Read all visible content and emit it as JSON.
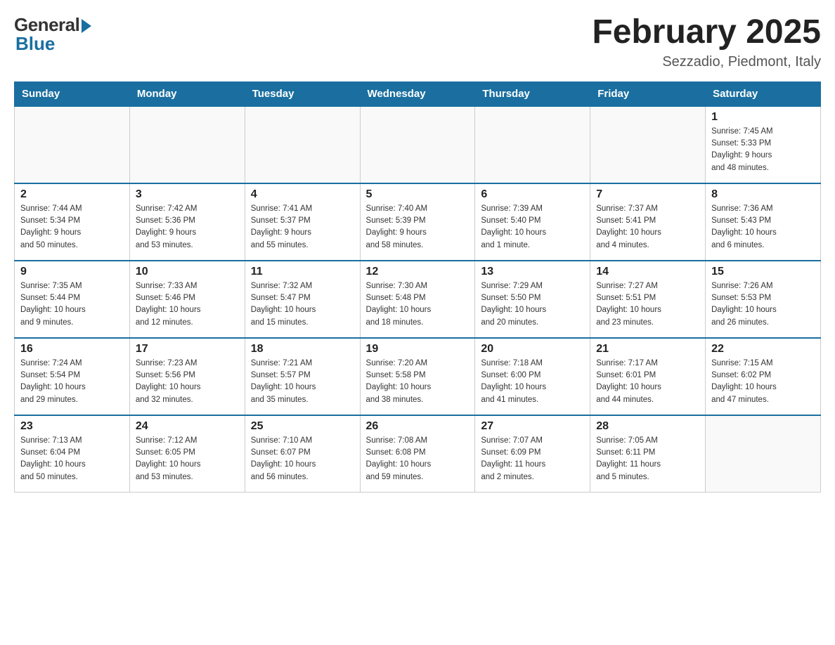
{
  "logo": {
    "general": "General",
    "blue": "Blue"
  },
  "title": "February 2025",
  "subtitle": "Sezzadio, Piedmont, Italy",
  "days_of_week": [
    "Sunday",
    "Monday",
    "Tuesday",
    "Wednesday",
    "Thursday",
    "Friday",
    "Saturday"
  ],
  "weeks": [
    [
      {
        "day": "",
        "info": ""
      },
      {
        "day": "",
        "info": ""
      },
      {
        "day": "",
        "info": ""
      },
      {
        "day": "",
        "info": ""
      },
      {
        "day": "",
        "info": ""
      },
      {
        "day": "",
        "info": ""
      },
      {
        "day": "1",
        "info": "Sunrise: 7:45 AM\nSunset: 5:33 PM\nDaylight: 9 hours\nand 48 minutes."
      }
    ],
    [
      {
        "day": "2",
        "info": "Sunrise: 7:44 AM\nSunset: 5:34 PM\nDaylight: 9 hours\nand 50 minutes."
      },
      {
        "day": "3",
        "info": "Sunrise: 7:42 AM\nSunset: 5:36 PM\nDaylight: 9 hours\nand 53 minutes."
      },
      {
        "day": "4",
        "info": "Sunrise: 7:41 AM\nSunset: 5:37 PM\nDaylight: 9 hours\nand 55 minutes."
      },
      {
        "day": "5",
        "info": "Sunrise: 7:40 AM\nSunset: 5:39 PM\nDaylight: 9 hours\nand 58 minutes."
      },
      {
        "day": "6",
        "info": "Sunrise: 7:39 AM\nSunset: 5:40 PM\nDaylight: 10 hours\nand 1 minute."
      },
      {
        "day": "7",
        "info": "Sunrise: 7:37 AM\nSunset: 5:41 PM\nDaylight: 10 hours\nand 4 minutes."
      },
      {
        "day": "8",
        "info": "Sunrise: 7:36 AM\nSunset: 5:43 PM\nDaylight: 10 hours\nand 6 minutes."
      }
    ],
    [
      {
        "day": "9",
        "info": "Sunrise: 7:35 AM\nSunset: 5:44 PM\nDaylight: 10 hours\nand 9 minutes."
      },
      {
        "day": "10",
        "info": "Sunrise: 7:33 AM\nSunset: 5:46 PM\nDaylight: 10 hours\nand 12 minutes."
      },
      {
        "day": "11",
        "info": "Sunrise: 7:32 AM\nSunset: 5:47 PM\nDaylight: 10 hours\nand 15 minutes."
      },
      {
        "day": "12",
        "info": "Sunrise: 7:30 AM\nSunset: 5:48 PM\nDaylight: 10 hours\nand 18 minutes."
      },
      {
        "day": "13",
        "info": "Sunrise: 7:29 AM\nSunset: 5:50 PM\nDaylight: 10 hours\nand 20 minutes."
      },
      {
        "day": "14",
        "info": "Sunrise: 7:27 AM\nSunset: 5:51 PM\nDaylight: 10 hours\nand 23 minutes."
      },
      {
        "day": "15",
        "info": "Sunrise: 7:26 AM\nSunset: 5:53 PM\nDaylight: 10 hours\nand 26 minutes."
      }
    ],
    [
      {
        "day": "16",
        "info": "Sunrise: 7:24 AM\nSunset: 5:54 PM\nDaylight: 10 hours\nand 29 minutes."
      },
      {
        "day": "17",
        "info": "Sunrise: 7:23 AM\nSunset: 5:56 PM\nDaylight: 10 hours\nand 32 minutes."
      },
      {
        "day": "18",
        "info": "Sunrise: 7:21 AM\nSunset: 5:57 PM\nDaylight: 10 hours\nand 35 minutes."
      },
      {
        "day": "19",
        "info": "Sunrise: 7:20 AM\nSunset: 5:58 PM\nDaylight: 10 hours\nand 38 minutes."
      },
      {
        "day": "20",
        "info": "Sunrise: 7:18 AM\nSunset: 6:00 PM\nDaylight: 10 hours\nand 41 minutes."
      },
      {
        "day": "21",
        "info": "Sunrise: 7:17 AM\nSunset: 6:01 PM\nDaylight: 10 hours\nand 44 minutes."
      },
      {
        "day": "22",
        "info": "Sunrise: 7:15 AM\nSunset: 6:02 PM\nDaylight: 10 hours\nand 47 minutes."
      }
    ],
    [
      {
        "day": "23",
        "info": "Sunrise: 7:13 AM\nSunset: 6:04 PM\nDaylight: 10 hours\nand 50 minutes."
      },
      {
        "day": "24",
        "info": "Sunrise: 7:12 AM\nSunset: 6:05 PM\nDaylight: 10 hours\nand 53 minutes."
      },
      {
        "day": "25",
        "info": "Sunrise: 7:10 AM\nSunset: 6:07 PM\nDaylight: 10 hours\nand 56 minutes."
      },
      {
        "day": "26",
        "info": "Sunrise: 7:08 AM\nSunset: 6:08 PM\nDaylight: 10 hours\nand 59 minutes."
      },
      {
        "day": "27",
        "info": "Sunrise: 7:07 AM\nSunset: 6:09 PM\nDaylight: 11 hours\nand 2 minutes."
      },
      {
        "day": "28",
        "info": "Sunrise: 7:05 AM\nSunset: 6:11 PM\nDaylight: 11 hours\nand 5 minutes."
      },
      {
        "day": "",
        "info": ""
      }
    ]
  ]
}
